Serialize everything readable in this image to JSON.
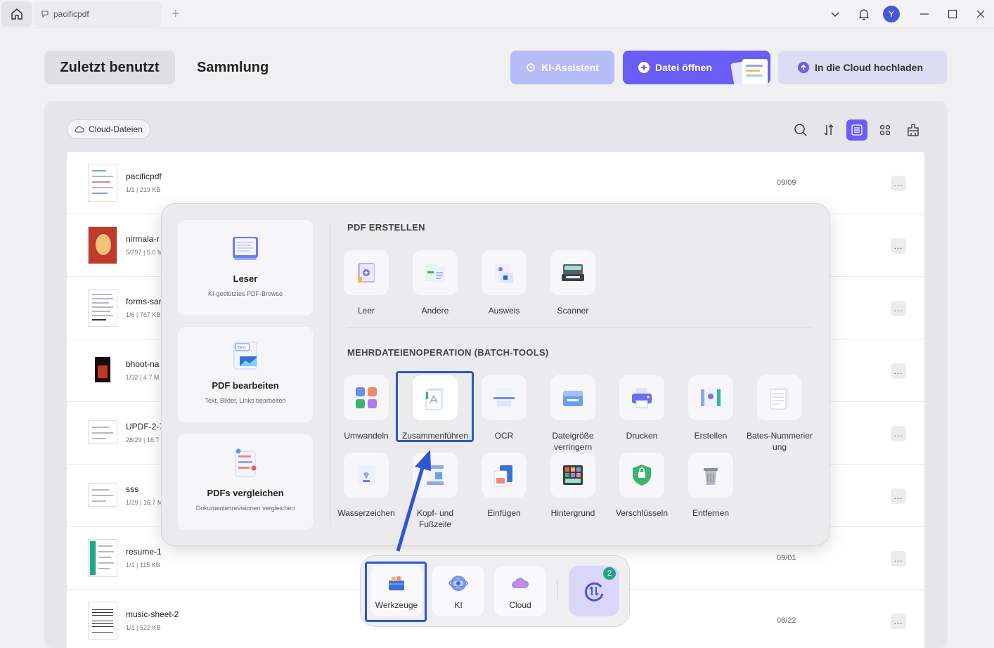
{
  "titlebar": {
    "tab_title": "pacificpdf",
    "tab_add": "+",
    "avatar_letter": "Y"
  },
  "top_tabs": {
    "recent": "Zuletzt benutzt",
    "collection": "Sammlung"
  },
  "buttons": {
    "ai": "KI-Assistent",
    "open": "Datei öffnen",
    "cloud": "In die Cloud hochladen"
  },
  "toolbar": {
    "cloud_files": "Cloud-Dateien"
  },
  "files": [
    {
      "name": "pacificpdf",
      "meta": "1/1 | 219 KB",
      "date": "09/09",
      "more": "..."
    },
    {
      "name": "nirmala-r",
      "meta": "5/297 | 5.0 M",
      "date": "",
      "more": "..."
    },
    {
      "name": "forms-sar",
      "meta": "1/6 | 767 KB",
      "date": "",
      "more": "..."
    },
    {
      "name": "bhoot-na",
      "meta": "1/32 | 4.7 M",
      "date": "",
      "more": "..."
    },
    {
      "name": "UPDF-2-7",
      "meta": "28/29 | 16.7",
      "date": "",
      "more": "..."
    },
    {
      "name": "sss",
      "meta": "1/29 | 16.7 M",
      "date": "",
      "more": "..."
    },
    {
      "name": "resume-1",
      "meta": "1/1 | 115 KB",
      "date": "09/01",
      "more": "..."
    },
    {
      "name": "music-sheet-2",
      "meta": "1/1 | 522 KB",
      "date": "08/22",
      "more": "..."
    }
  ],
  "popup": {
    "cards": [
      {
        "title": "Leser",
        "subtitle": "KI-gestütztes PDF-Browse"
      },
      {
        "title": "PDF bearbeiten",
        "subtitle": "Text, Bilder, Links bearbeiten"
      },
      {
        "title": "PDFs vergleichen",
        "subtitle": "Dokumentenrevisionen vergleichen"
      }
    ],
    "section_create": "PDF ERSTELLEN",
    "create_tools": [
      "Leer",
      "Andere",
      "Ausweis",
      "Scanner"
    ],
    "section_batch": "MEHRDATEIENOPERATION (BATCH-TOOLS)",
    "batch_row1": [
      "Umwandeln",
      "Zusammenführen",
      "OCR",
      "Dateigröße verringern",
      "Drucken",
      "Erstellen",
      "Bates-Nummerier ung"
    ],
    "batch_row2": [
      "Wasserzeichen",
      "Kopf- und Fußzeile",
      "Einfügen",
      "Hintergrund",
      "Verschlüsseln",
      "Entfernen"
    ],
    "card_icon_text": "Text"
  },
  "dock": {
    "tools": "Werkzeuge",
    "ai": "KI",
    "cloud": "Cloud",
    "badge": "2"
  },
  "colors": {
    "accent": "#6b5cf6",
    "highlight": "#2c55d8",
    "badge": "#1fa68a"
  }
}
